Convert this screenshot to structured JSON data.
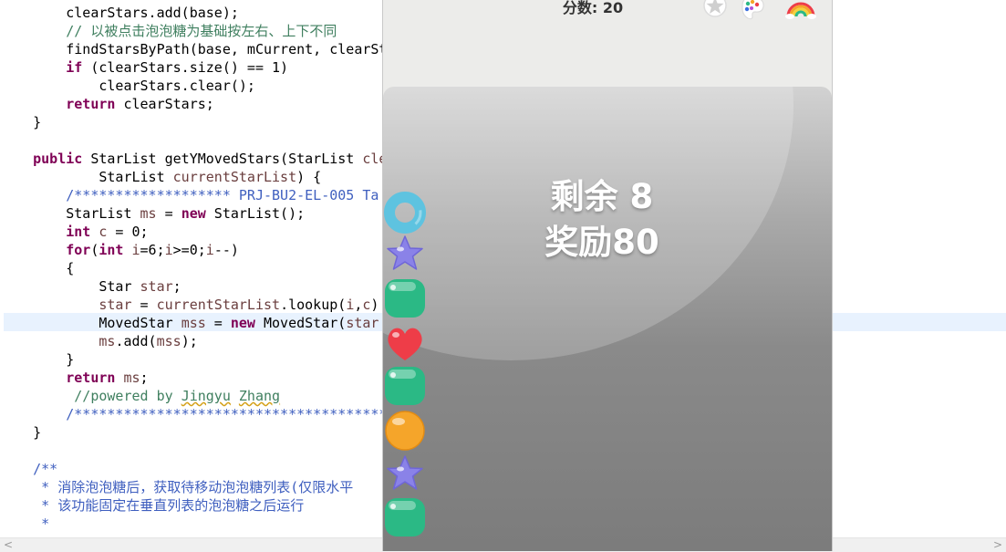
{
  "editor": {
    "lines": [
      {
        "html": "        clearStars.add(base);"
      },
      {
        "html": "        <span class=\"cm\">// 以被点击泡泡糖为基础按左右、上下不同</span>"
      },
      {
        "html": "        findStarsByPath(base, mCurrent, clearSt"
      },
      {
        "html": "        <span class=\"kw\">if</span> (clearStars.size() == 1)"
      },
      {
        "html": "            clearStars.clear();"
      },
      {
        "html": "        <span class=\"kw\">return</span> clearStars;"
      },
      {
        "html": "    }"
      },
      {
        "html": ""
      },
      {
        "html": "    <span class=\"kw\">public</span> StarList getYMovedStars(StarList <span class=\"var\">cle</span>"
      },
      {
        "html": "            StarList <span class=\"var\">currentStarList</span>) {"
      },
      {
        "html": "        <span class=\"jd\">/******************* PRJ-BU2-EL-005 Ta</span>"
      },
      {
        "html": "        StarList <span class=\"var\">ms</span> = <span class=\"kw\">new</span> StarList();"
      },
      {
        "html": "        <span class=\"kw\">int</span> <span class=\"var\">c</span> = 0;"
      },
      {
        "html": "        <span class=\"kw\">for</span>(<span class=\"kw\">int</span> <span class=\"var\">i</span>=6;<span class=\"var\">i</span>&gt;=0;<span class=\"var\">i</span>--)"
      },
      {
        "html": "        {"
      },
      {
        "html": "            Star <span class=\"var\">star</span>;"
      },
      {
        "html": "            <span class=\"var\">star</span> = <span class=\"var\">currentStarList</span>.lookup(<span class=\"var\">i</span>,<span class=\"var\">c</span>)"
      },
      {
        "html": "            MovedStar <span class=\"var\">mss</span> = <span class=\"kw\">new</span> MovedStar(<span class=\"var\">star</span>"
      },
      {
        "html": "            <span class=\"var\">ms</span>.add(<span class=\"var\">mss</span>);"
      },
      {
        "html": "        }"
      },
      {
        "html": "        <span class=\"kw\">return</span> <span class=\"var\">ms</span>;"
      },
      {
        "html": "         <span class=\"cm\">//powered by <span class=\"sq\">Jingyu</span> <span class=\"sq\">Zhang</span></span>"
      },
      {
        "html": "        <span class=\"jd\">/****************************************</span>"
      },
      {
        "html": "    }"
      },
      {
        "html": ""
      },
      {
        "html": "    <span class=\"jd\">/**</span>"
      },
      {
        "html": "     <span class=\"jd\">* 消除泡泡糖后，获取待移动泡泡糖列表(仅限水平</span>"
      },
      {
        "html": "     <span class=\"jd\">* 该功能固定在垂直列表的泡泡糖之后运行</span>"
      },
      {
        "html": "     <span class=\"jd\">*</span>"
      }
    ]
  },
  "game": {
    "score_text": "分数: 20",
    "message_line1": "剩余 8",
    "message_line2": "奖励80",
    "icons": [
      "star-icon",
      "palette-icon",
      "rainbow-icon"
    ],
    "candies": [
      "donut",
      "star",
      "green",
      "heart",
      "green",
      "orange",
      "star",
      "green"
    ],
    "colors": {
      "cyan": "#5ec3e0",
      "purple": "#8a82e8",
      "green": "#2bb985",
      "red": "#ee3d48",
      "orange": "#f5a52a"
    }
  },
  "scrollbar": {
    "left_arrow": "<",
    "right_arrow": ">"
  }
}
